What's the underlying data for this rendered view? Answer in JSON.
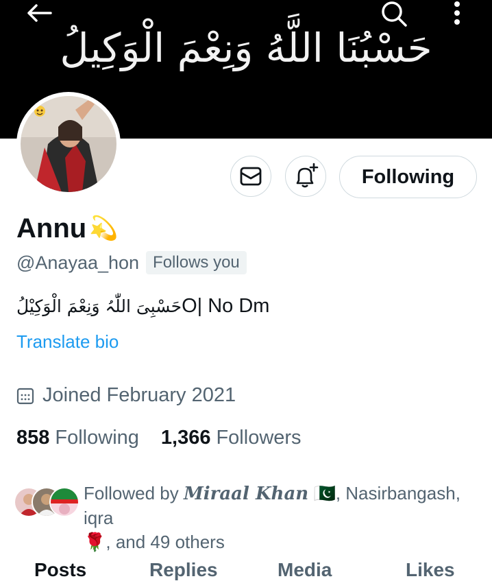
{
  "banner": {
    "arabic_text": "حَسْبُنَا اللَّهُ وَنِعْمَ الْوَكِيلُ"
  },
  "header": {
    "back_icon": "arrow-left-icon",
    "search_icon": "search-icon",
    "more_icon": "more-vertical-icon"
  },
  "profile": {
    "name": "Annu",
    "name_emoji": "💫",
    "handle": "@Anayaa_hon",
    "follows_you": "Follows you",
    "bio_arabic": "حَسْبِیَ اللّٰہُ وَنِعْمَ الْوَكِيْلُ",
    "bio_rest": "O| No Dm",
    "translate": "Translate bio",
    "joined": "Joined February 2021",
    "following_count": "858",
    "following_label": "Following",
    "followers_count": "1,366",
    "followers_label": "Followers"
  },
  "actions": {
    "mail_icon": "mail-icon",
    "bell_icon": "bell-plus-icon",
    "following_button": "Following"
  },
  "followed_by": {
    "prefix": "Followed by ",
    "name1": "Miraal Khan",
    "flag": "🇵🇰",
    "rest1": ", Nasirbangash, iqra",
    "rose": "🌹",
    "rest2": ", and 49 others"
  },
  "tabs": [
    "Posts",
    "Replies",
    "Media",
    "Likes"
  ],
  "colors": {
    "accent": "#1d9bf0",
    "secondary_text": "#536471",
    "border": "#cfd9de"
  }
}
